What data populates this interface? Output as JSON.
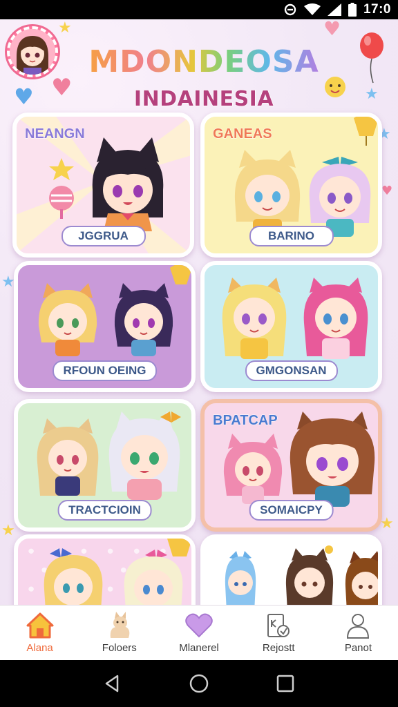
{
  "status_bar": {
    "time": "17:0",
    "icons": [
      "no-disturb-icon",
      "wifi-icon",
      "signal-icon",
      "battery-icon"
    ]
  },
  "header": {
    "title": "MDONDEOSA",
    "subtitle": "INDAINESIA"
  },
  "cards": [
    {
      "label": "JGGRUA",
      "corner_text": "NEANGN",
      "bg": "#fbe2ee"
    },
    {
      "label": "BARINO",
      "corner_text": "GANEAS",
      "bg": "#fbf2b8"
    },
    {
      "label": "RFOUN OEING",
      "corner_text": "",
      "bg": "#c99ad9"
    },
    {
      "label": "GMGONSAN",
      "corner_text": "",
      "bg": "#c9ecf2"
    },
    {
      "label": "TRACTCIOIN",
      "corner_text": "",
      "bg": "#d8efd2"
    },
    {
      "label": "SOMAICPY",
      "corner_text": "BPATCAP",
      "bg": "#f8d8ea"
    },
    {
      "label": "",
      "corner_text": "",
      "bg": "#f8d6ec"
    },
    {
      "label": "",
      "corner_text": "",
      "bg": "#ffffff"
    }
  ],
  "bottom_nav": [
    {
      "label": "Alana",
      "icon": "home-icon",
      "active": true
    },
    {
      "label": "Foloers",
      "icon": "cat-icon",
      "active": false
    },
    {
      "label": "Mlanerel",
      "icon": "heart-icon",
      "active": false
    },
    {
      "label": "Rejostt",
      "icon": "shop-icon",
      "active": false
    },
    {
      "label": "Panot",
      "icon": "profile-icon",
      "active": false
    }
  ],
  "colors": {
    "accent": "#ef6a3b",
    "title_pink": "#b5417d",
    "label_text": "#3e5a8a"
  }
}
